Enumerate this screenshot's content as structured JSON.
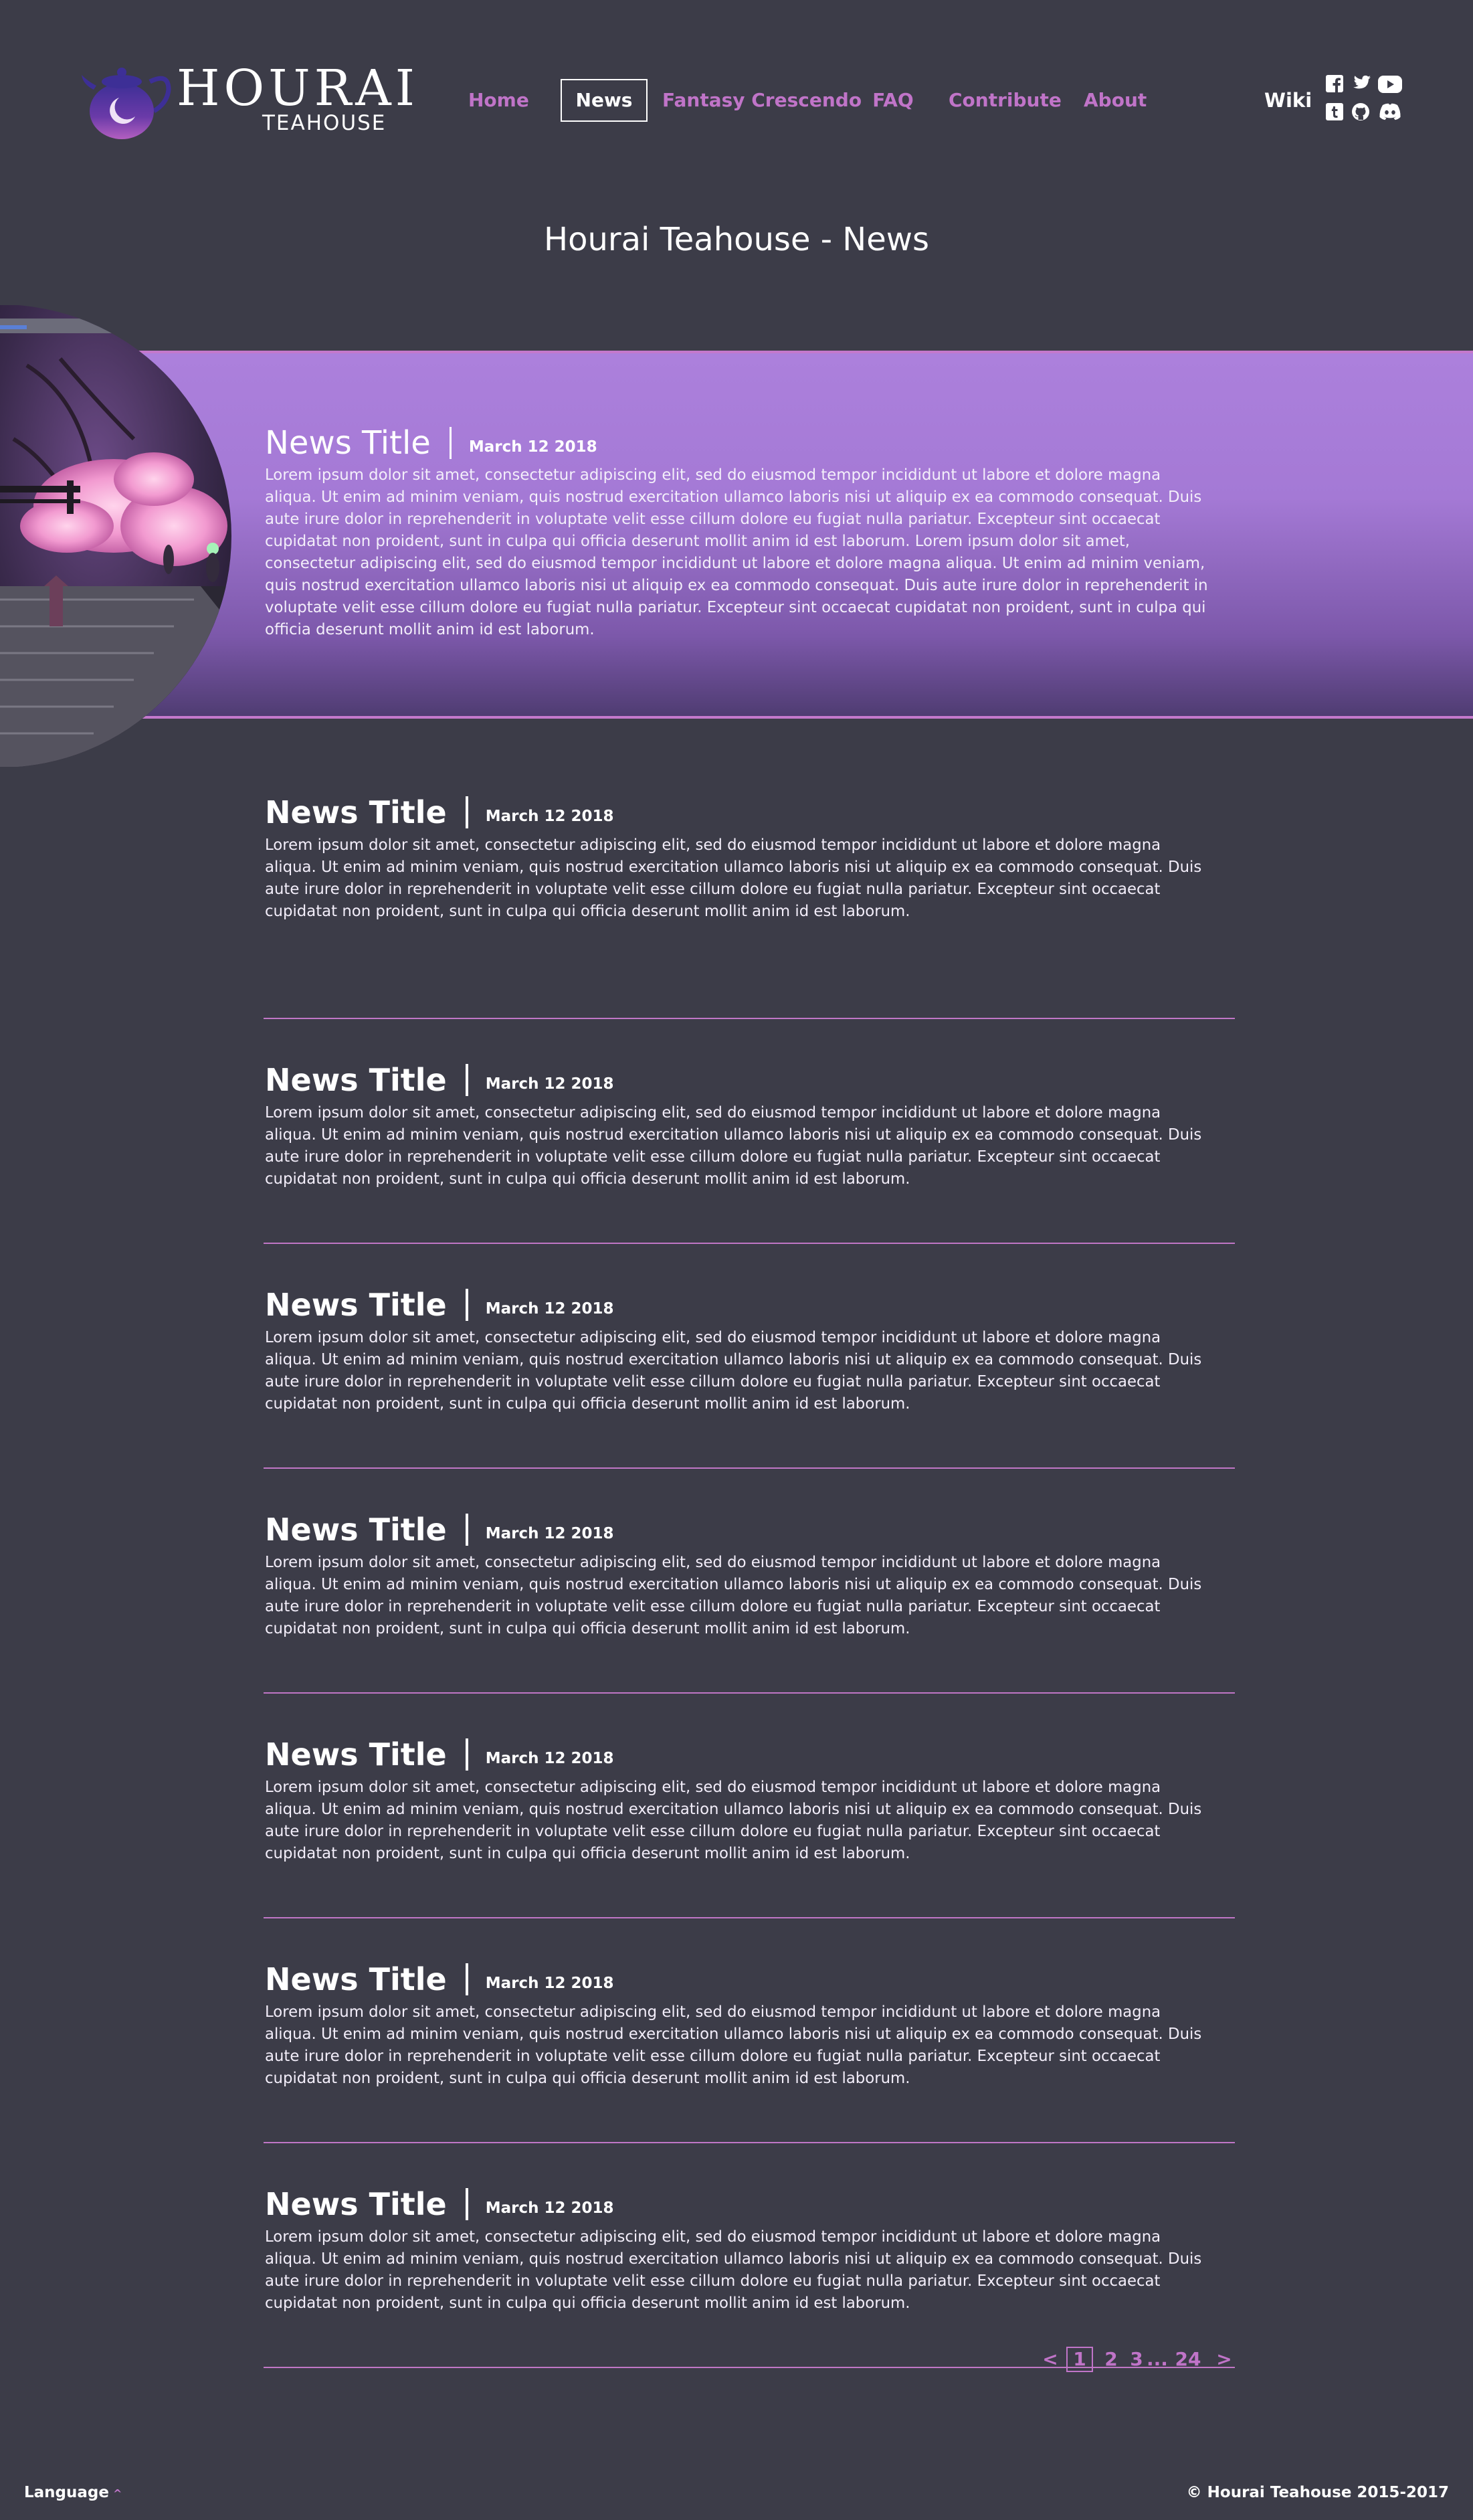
{
  "header": {
    "logo_main": "HOURAI",
    "logo_sub": "TEAHOUSE",
    "nav": [
      {
        "label": "Home"
      },
      {
        "label": "News",
        "active": true
      },
      {
        "label": "Fantasy Crescendo"
      },
      {
        "label": "FAQ"
      },
      {
        "label": "Contribute"
      },
      {
        "label": "About"
      }
    ],
    "wiki_label": "Wiki",
    "social_icons": [
      "facebook-icon",
      "twitter-icon",
      "youtube-icon",
      "tumblr-icon",
      "github-icon",
      "discord-icon"
    ]
  },
  "page_title": "Hourai Teahouse - News",
  "featured": {
    "title": "News Title",
    "date": "March 12 2018",
    "body": "Lorem ipsum dolor sit amet, consectetur adipiscing elit, sed do eiusmod tempor incididunt ut labore et dolore magna aliqua. Ut enim ad minim veniam, quis nostrud exercitation ullamco laboris nisi ut aliquip ex ea commodo consequat. Duis aute irure dolor in reprehenderit in voluptate velit esse cillum dolore eu fugiat nulla pariatur. Excepteur sint occaecat cupidatat non proident, sunt in culpa qui officia deserunt mollit anim id est laborum. Lorem ipsum dolor sit amet, consectetur adipiscing elit, sed do eiusmod tempor incididunt ut labore et dolore magna aliqua. Ut enim ad minim veniam, quis nostrud exercitation ullamco laboris nisi ut aliquip ex ea commodo consequat. Duis aute irure dolor in reprehenderit in voluptate velit esse cillum dolore eu fugiat nulla pariatur. Excepteur sint occaecat cupidatat non proident, sunt in culpa qui officia deserunt mollit anim id est laborum."
  },
  "articles": [
    {
      "title": "News Title",
      "date": "March 12 2018",
      "body": "Lorem ipsum dolor sit amet, consectetur adipiscing elit, sed do eiusmod tempor incididunt ut labore et dolore magna aliqua. Ut enim ad minim veniam, quis nostrud exercitation ullamco laboris nisi ut aliquip ex ea commodo consequat. Duis aute irure dolor in reprehenderit in voluptate velit esse cillum dolore eu fugiat nulla pariatur. Excepteur sint occaecat cupidatat non proident, sunt in culpa qui officia deserunt mollit anim id est laborum."
    },
    {
      "title": "News Title",
      "date": "March 12 2018",
      "body": "Lorem ipsum dolor sit amet, consectetur adipiscing elit, sed do eiusmod tempor incididunt ut labore et dolore magna aliqua. Ut enim ad minim veniam, quis nostrud exercitation ullamco laboris nisi ut aliquip ex ea commodo consequat. Duis aute irure dolor in reprehenderit in voluptate velit esse cillum dolore eu fugiat nulla pariatur. Excepteur sint occaecat cupidatat non proident, sunt in culpa qui officia deserunt mollit anim id est laborum."
    },
    {
      "title": "News Title",
      "date": "March 12 2018",
      "body": "Lorem ipsum dolor sit amet, consectetur adipiscing elit, sed do eiusmod tempor incididunt ut labore et dolore magna aliqua. Ut enim ad minim veniam, quis nostrud exercitation ullamco laboris nisi ut aliquip ex ea commodo consequat. Duis aute irure dolor in reprehenderit in voluptate velit esse cillum dolore eu fugiat nulla pariatur. Excepteur sint occaecat cupidatat non proident, sunt in culpa qui officia deserunt mollit anim id est laborum."
    },
    {
      "title": "News Title",
      "date": "March 12 2018",
      "body": "Lorem ipsum dolor sit amet, consectetur adipiscing elit, sed do eiusmod tempor incididunt ut labore et dolore magna aliqua. Ut enim ad minim veniam, quis nostrud exercitation ullamco laboris nisi ut aliquip ex ea commodo consequat. Duis aute irure dolor in reprehenderit in voluptate velit esse cillum dolore eu fugiat nulla pariatur. Excepteur sint occaecat cupidatat non proident, sunt in culpa qui officia deserunt mollit anim id est laborum."
    },
    {
      "title": "News Title",
      "date": "March 12 2018",
      "body": "Lorem ipsum dolor sit amet, consectetur adipiscing elit, sed do eiusmod tempor incididunt ut labore et dolore magna aliqua. Ut enim ad minim veniam, quis nostrud exercitation ullamco laboris nisi ut aliquip ex ea commodo consequat. Duis aute irure dolor in reprehenderit in voluptate velit esse cillum dolore eu fugiat nulla pariatur. Excepteur sint occaecat cupidatat non proident, sunt in culpa qui officia deserunt mollit anim id est laborum."
    },
    {
      "title": "News Title",
      "date": "March 12 2018",
      "body": "Lorem ipsum dolor sit amet, consectetur adipiscing elit, sed do eiusmod tempor incididunt ut labore et dolore magna aliqua. Ut enim ad minim veniam, quis nostrud exercitation ullamco laboris nisi ut aliquip ex ea commodo consequat. Duis aute irure dolor in reprehenderit in voluptate velit esse cillum dolore eu fugiat nulla pariatur. Excepteur sint occaecat cupidatat non proident, sunt in culpa qui officia deserunt mollit anim id est laborum."
    },
    {
      "title": "News Title",
      "date": "March 12 2018",
      "body": "Lorem ipsum dolor sit amet, consectetur adipiscing elit, sed do eiusmod tempor incididunt ut labore et dolore magna aliqua. Ut enim ad minim veniam, quis nostrud exercitation ullamco laboris nisi ut aliquip ex ea commodo consequat. Duis aute irure dolor in reprehenderit in voluptate velit esse cillum dolore eu fugiat nulla pariatur. Excepteur sint occaecat cupidatat non proident, sunt in culpa qui officia deserunt mollit anim id est laborum."
    }
  ],
  "pagination": {
    "prev": "<",
    "current": "1",
    "pages": [
      "2",
      "3"
    ],
    "ellipsis": "...",
    "last": "24",
    "next": ">"
  },
  "footer": {
    "language_label": "Language",
    "language_caret": "^",
    "copyright": "© Hourai Teahouse 2015-2017"
  },
  "colors": {
    "background": "#3c3c48",
    "accent": "#c074c8",
    "featured_top": "#ac80dc",
    "featured_bottom": "#4f3c72"
  }
}
